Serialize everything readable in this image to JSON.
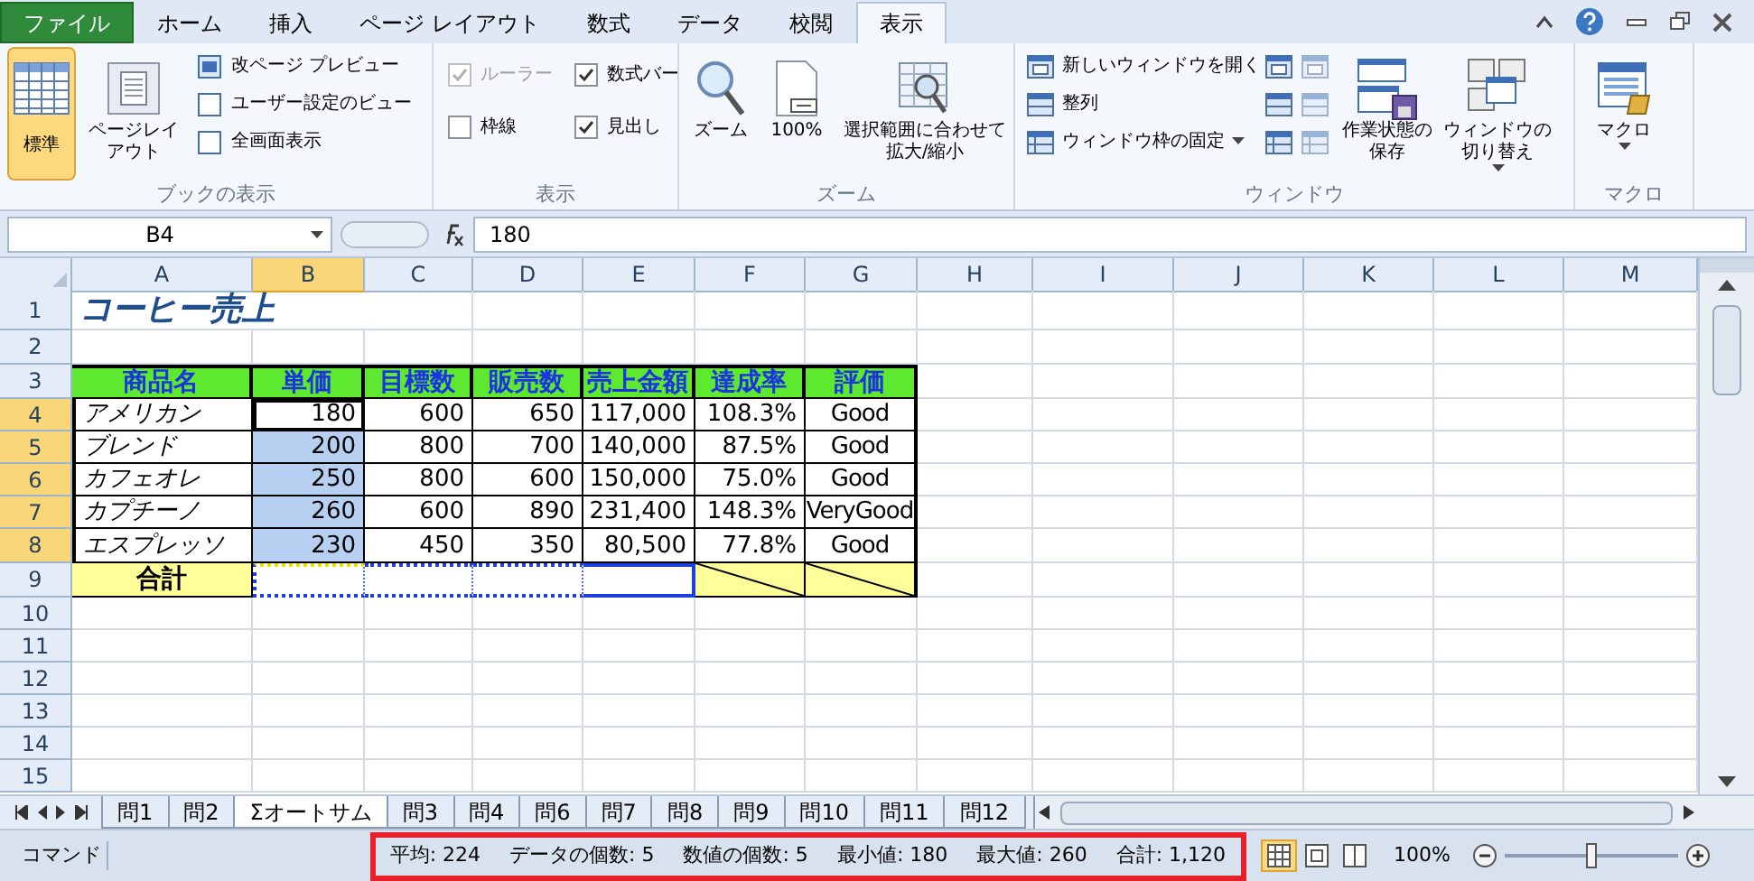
{
  "ribbon_tabs": [
    {
      "label": "ファイル",
      "kind": "file",
      "selected": false
    },
    {
      "label": "ホーム",
      "kind": "tab",
      "selected": false
    },
    {
      "label": "挿入",
      "kind": "tab",
      "selected": false
    },
    {
      "label": "ページ レイアウト",
      "kind": "tab",
      "selected": false
    },
    {
      "label": "数式",
      "kind": "tab",
      "selected": false
    },
    {
      "label": "データ",
      "kind": "tab",
      "selected": false
    },
    {
      "label": "校閲",
      "kind": "tab",
      "selected": false
    },
    {
      "label": "表示",
      "kind": "tab",
      "selected": true
    }
  ],
  "ribbon_groups": [
    {
      "title": "ブックの表示",
      "items": [
        {
          "label": "標準",
          "kind": "large",
          "selected": true
        },
        {
          "label": "ページレイアウト",
          "kind": "large",
          "selected": false
        },
        {
          "label": "改ページ プレビュー",
          "kind": "small"
        },
        {
          "label": "ユーザー設定のビュー",
          "kind": "small"
        },
        {
          "label": "全画面表示",
          "kind": "small"
        }
      ]
    },
    {
      "title": "表示",
      "items": [
        {
          "label": "ルーラー",
          "kind": "checkbox",
          "checked": true,
          "disabled": true
        },
        {
          "label": "数式バー",
          "kind": "checkbox",
          "checked": true,
          "disabled": false
        },
        {
          "label": "枠線",
          "kind": "checkbox",
          "checked": false,
          "disabled": false
        },
        {
          "label": "見出し",
          "kind": "checkbox",
          "checked": true,
          "disabled": false
        }
      ]
    },
    {
      "title": "ズーム",
      "items": [
        {
          "label": "ズーム",
          "kind": "large"
        },
        {
          "label": "100%",
          "kind": "large"
        },
        {
          "label": "選択範囲に合わせて拡大/縮小",
          "kind": "large"
        }
      ]
    },
    {
      "title": "ウィンドウ",
      "items": [
        {
          "label": "新しいウィンドウを開く",
          "kind": "small",
          "dropdown": false
        },
        {
          "label": "整列",
          "kind": "small",
          "dropdown": false
        },
        {
          "label": "ウィンドウ枠の固定",
          "kind": "small",
          "dropdown": true
        },
        {
          "label": "作業状態の保存",
          "kind": "large",
          "dropdown": false
        },
        {
          "label": "ウィンドウの切り替え",
          "kind": "large",
          "dropdown": true
        }
      ]
    },
    {
      "title": "マクロ",
      "items": [
        {
          "label": "マクロ",
          "kind": "large",
          "dropdown": true
        }
      ]
    }
  ],
  "formula_bar": {
    "name_box": "B4",
    "formula": "180"
  },
  "columns": [
    {
      "label": "A",
      "selected": false
    },
    {
      "label": "B",
      "selected": true
    },
    {
      "label": "C",
      "selected": false
    },
    {
      "label": "D",
      "selected": false
    },
    {
      "label": "E",
      "selected": false
    },
    {
      "label": "F",
      "selected": false
    },
    {
      "label": "G",
      "selected": false
    },
    {
      "label": "H",
      "selected": false
    },
    {
      "label": "I",
      "selected": false
    },
    {
      "label": "J",
      "selected": false
    },
    {
      "label": "K",
      "selected": false
    },
    {
      "label": "L",
      "selected": false
    },
    {
      "label": "M",
      "selected": false
    }
  ],
  "rows": [
    {
      "number": "1",
      "kind": "title",
      "selected": false,
      "cells": [
        "コーヒー売上"
      ]
    },
    {
      "number": "2",
      "kind": "empty",
      "selected": false
    },
    {
      "number": "3",
      "kind": "header",
      "selected": false,
      "cells": [
        "商品名",
        "単価",
        "目標数",
        "販売数",
        "売上金額",
        "達成率",
        "評価"
      ]
    },
    {
      "number": "4",
      "kind": "data",
      "selected": true,
      "active": true,
      "cells": [
        "アメリカン",
        "180",
        "600",
        "650",
        "117,000",
        "108.3%",
        "Good"
      ]
    },
    {
      "number": "5",
      "kind": "data",
      "selected": true,
      "active": false,
      "cells": [
        "ブレンド",
        "200",
        "800",
        "700",
        "140,000",
        "87.5%",
        "Good"
      ]
    },
    {
      "number": "6",
      "kind": "data",
      "selected": true,
      "active": false,
      "cells": [
        "カフェオレ",
        "250",
        "800",
        "600",
        "150,000",
        "75.0%",
        "Good"
      ]
    },
    {
      "number": "7",
      "kind": "data",
      "selected": true,
      "active": false,
      "cells": [
        "カプチーノ",
        "260",
        "600",
        "890",
        "231,400",
        "148.3%",
        "VeryGood"
      ]
    },
    {
      "number": "8",
      "kind": "data",
      "selected": true,
      "active": false,
      "cells": [
        "エスプレッソ",
        "230",
        "450",
        "350",
        "80,500",
        "77.8%",
        "Good"
      ]
    },
    {
      "number": "9",
      "kind": "total",
      "selected": false,
      "cells": [
        "合計"
      ]
    },
    {
      "number": "10",
      "kind": "empty",
      "selected": false
    },
    {
      "number": "11",
      "kind": "empty",
      "selected": false
    },
    {
      "number": "12",
      "kind": "empty",
      "selected": false
    },
    {
      "number": "13",
      "kind": "empty",
      "selected": false
    },
    {
      "number": "14",
      "kind": "empty",
      "selected": false
    },
    {
      "number": "15",
      "kind": "empty",
      "selected": false
    }
  ],
  "sheet_tabs": [
    {
      "label": "問1",
      "selected": false
    },
    {
      "label": "問2",
      "selected": false
    },
    {
      "label": "Σオートサム",
      "selected": true
    },
    {
      "label": "問3",
      "selected": false
    },
    {
      "label": "問4",
      "selected": false
    },
    {
      "label": "問6",
      "selected": false
    },
    {
      "label": "問7",
      "selected": false
    },
    {
      "label": "問8",
      "selected": false
    },
    {
      "label": "問9",
      "selected": false
    },
    {
      "label": "問10",
      "selected": false
    },
    {
      "label": "問11",
      "selected": false
    },
    {
      "label": "問12",
      "selected": false
    }
  ],
  "status_bar": {
    "mode": "コマンド",
    "stats": [
      "平均: 224",
      "データの個数: 5",
      "数値の個数: 5",
      "最小値: 180",
      "最大値: 260",
      "合計: 1,120"
    ],
    "views": [
      {
        "kind": "normal",
        "selected": true
      },
      {
        "kind": "layout",
        "selected": false
      },
      {
        "kind": "pagebreak",
        "selected": false
      }
    ],
    "zoom": "100%",
    "zoom_slider": {
      "level": 0.5
    }
  }
}
